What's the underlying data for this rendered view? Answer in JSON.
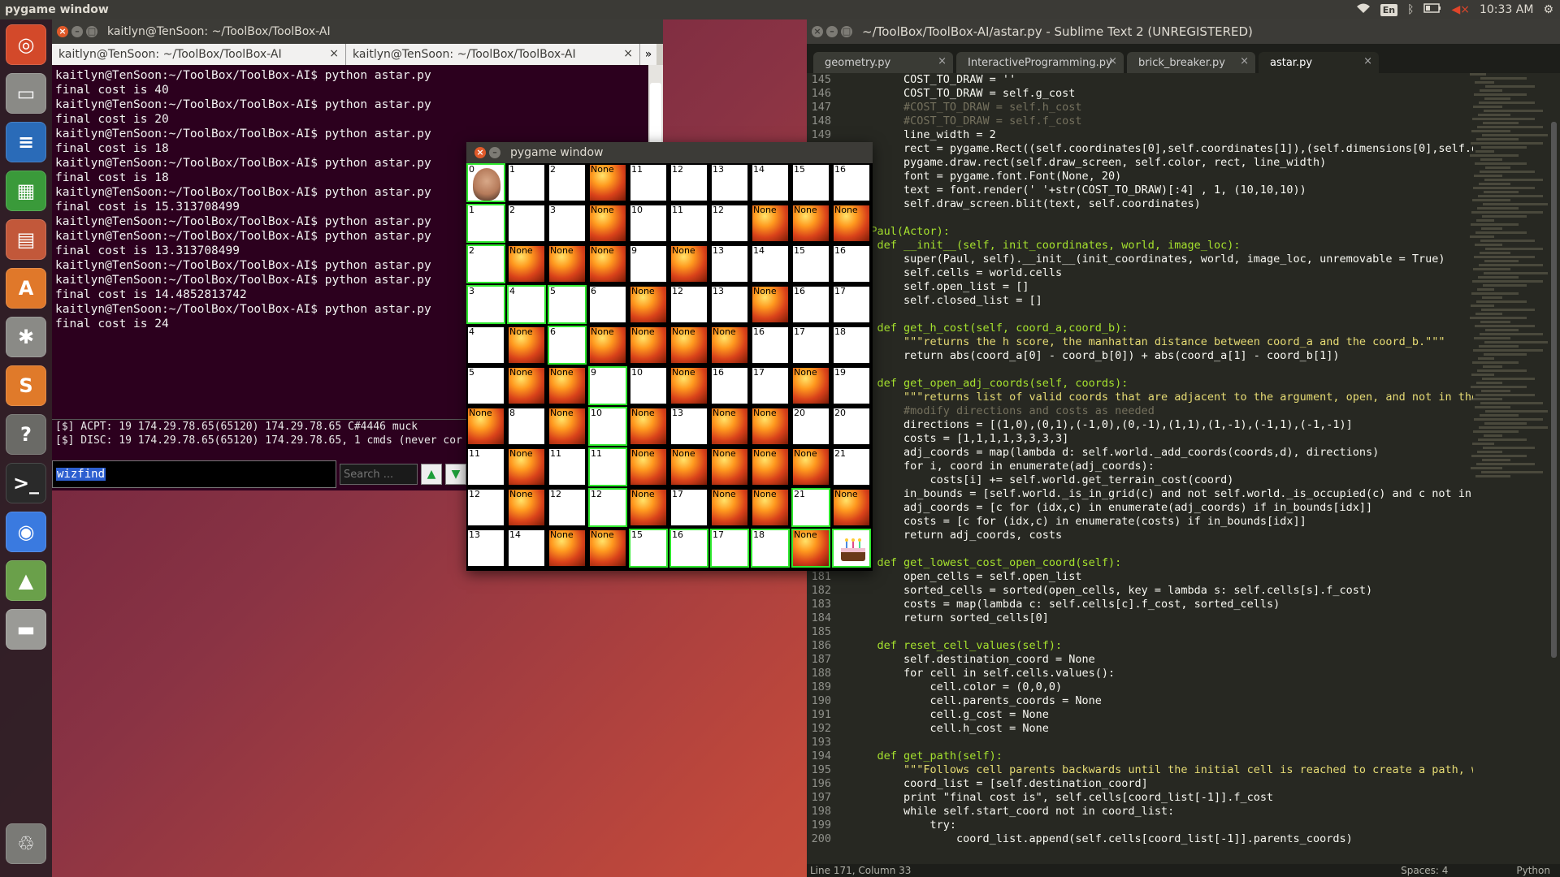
{
  "top_panel": {
    "title": "pygame window",
    "lang": "En",
    "clock": "10:33 AM"
  },
  "launcher": {
    "items": [
      {
        "name": "dash",
        "glyph": "◎",
        "color": "#d3492a"
      },
      {
        "name": "files",
        "glyph": "▭",
        "color": "#8a8a86"
      },
      {
        "name": "writer",
        "glyph": "≡",
        "color": "#2a6bb8"
      },
      {
        "name": "calc",
        "glyph": "▦",
        "color": "#3a9a3a"
      },
      {
        "name": "impress",
        "glyph": "▤",
        "color": "#c2583a"
      },
      {
        "name": "software-center",
        "glyph": "A",
        "color": "#e0782a"
      },
      {
        "name": "settings",
        "glyph": "✱",
        "color": "#8a8a86"
      },
      {
        "name": "sublime",
        "glyph": "S",
        "color": "#e07a2a"
      },
      {
        "name": "help",
        "glyph": "?",
        "color": "#6a6a66"
      },
      {
        "name": "terminal",
        "glyph": ">_",
        "color": "#2a2a2a"
      },
      {
        "name": "chrome",
        "glyph": "◉",
        "color": "#3a7ae0"
      },
      {
        "name": "image-viewer",
        "glyph": "▲",
        "color": "#6aa04a"
      },
      {
        "name": "disk",
        "glyph": "▬",
        "color": "#9a9a96"
      },
      {
        "name": "trash",
        "glyph": "♲",
        "color": "#7a7a76"
      }
    ]
  },
  "terminal": {
    "title": "kaitlyn@TenSoon: ~/ToolBox/ToolBox-AI",
    "tabs": [
      "kaitlyn@TenSoon: ~/ToolBox/ToolBox-AI",
      "kaitlyn@TenSoon: ~/ToolBox/ToolBox-AI"
    ],
    "output": "kaitlyn@TenSoon:~/ToolBox/ToolBox-AI$ python astar.py\nfinal cost is 40\nkaitlyn@TenSoon:~/ToolBox/ToolBox-AI$ python astar.py\nfinal cost is 20\nkaitlyn@TenSoon:~/ToolBox/ToolBox-AI$ python astar.py\nfinal cost is 18\nkaitlyn@TenSoon:~/ToolBox/ToolBox-AI$ python astar.py\nfinal cost is 18\nkaitlyn@TenSoon:~/ToolBox/ToolBox-AI$ python astar.py\nfinal cost is 15.313708499\nkaitlyn@TenSoon:~/ToolBox/ToolBox-AI$ python astar.py\nkaitlyn@TenSoon:~/ToolBox/ToolBox-AI$ python astar.py\nfinal cost is 13.313708499\nkaitlyn@TenSoon:~/ToolBox/ToolBox-AI$ python astar.py\nkaitlyn@TenSoon:~/ToolBox/ToolBox-AI$ python astar.py\nfinal cost is 14.4852813742\nkaitlyn@TenSoon:~/ToolBox/ToolBox-AI$ python astar.py\nfinal cost is 24",
    "irc_log": "[$] ACPT: 19 174.29.78.65(65120) 174.29.78.65 C#4446 muck\n[$] DISC: 19 174.29.78.65(65120) 174.29.78.65, 1 cmds (never cor",
    "input_value": "wizfind",
    "search_placeholder": "Search ...",
    "more_glyph": "»"
  },
  "pygame": {
    "title": "pygame window",
    "none_label": "None",
    "grid": [
      [
        {
          "t": "0",
          "k": "avatar",
          "g": 1
        },
        {
          "t": "1"
        },
        {
          "t": "2"
        },
        {
          "t": "None",
          "k": "fire"
        },
        {
          "t": "11"
        },
        {
          "t": "12"
        },
        {
          "t": "13"
        },
        {
          "t": "14"
        },
        {
          "t": "15"
        },
        {
          "t": "16"
        }
      ],
      [
        {
          "t": "1",
          "g": 1
        },
        {
          "t": "2"
        },
        {
          "t": "3"
        },
        {
          "t": "None",
          "k": "fire"
        },
        {
          "t": "10"
        },
        {
          "t": "11"
        },
        {
          "t": "12"
        },
        {
          "t": "None",
          "k": "fire"
        },
        {
          "t": "None",
          "k": "fire"
        },
        {
          "t": "None",
          "k": "fire"
        }
      ],
      [
        {
          "t": "2",
          "g": 1
        },
        {
          "t": "None",
          "k": "fire"
        },
        {
          "t": "None",
          "k": "fire"
        },
        {
          "t": "None",
          "k": "fire"
        },
        {
          "t": "9"
        },
        {
          "t": "None",
          "k": "fire"
        },
        {
          "t": "13"
        },
        {
          "t": "14"
        },
        {
          "t": "15"
        },
        {
          "t": "16"
        }
      ],
      [
        {
          "t": "3",
          "g": 1
        },
        {
          "t": "4",
          "g": 1
        },
        {
          "t": "5",
          "g": 1
        },
        {
          "t": "6"
        },
        {
          "t": "None",
          "k": "fire"
        },
        {
          "t": "12"
        },
        {
          "t": "13"
        },
        {
          "t": "None",
          "k": "fire"
        },
        {
          "t": "16"
        },
        {
          "t": "17"
        }
      ],
      [
        {
          "t": "4"
        },
        {
          "t": "None",
          "k": "fire"
        },
        {
          "t": "6",
          "g": 1
        },
        {
          "t": "None",
          "k": "fire"
        },
        {
          "t": "None",
          "k": "fire"
        },
        {
          "t": "None",
          "k": "fire"
        },
        {
          "t": "None",
          "k": "fire"
        },
        {
          "t": "16"
        },
        {
          "t": "17"
        },
        {
          "t": "18"
        }
      ],
      [
        {
          "t": "5"
        },
        {
          "t": "None",
          "k": "fire"
        },
        {
          "t": "None",
          "k": "fire"
        },
        {
          "t": "9",
          "g": 1
        },
        {
          "t": "10"
        },
        {
          "t": "None",
          "k": "fire"
        },
        {
          "t": "16"
        },
        {
          "t": "17"
        },
        {
          "t": "None",
          "k": "fire"
        },
        {
          "t": "19"
        }
      ],
      [
        {
          "t": "None",
          "k": "fire"
        },
        {
          "t": "8"
        },
        {
          "t": "None",
          "k": "fire"
        },
        {
          "t": "10",
          "g": 1
        },
        {
          "t": "None",
          "k": "fire"
        },
        {
          "t": "13"
        },
        {
          "t": "None",
          "k": "fire"
        },
        {
          "t": "None",
          "k": "fire"
        },
        {
          "t": "20"
        },
        {
          "t": "20"
        }
      ],
      [
        {
          "t": "11"
        },
        {
          "t": "None",
          "k": "fire"
        },
        {
          "t": "11"
        },
        {
          "t": "11",
          "g": 1
        },
        {
          "t": "None",
          "k": "fire"
        },
        {
          "t": "None",
          "k": "fire"
        },
        {
          "t": "None",
          "k": "fire"
        },
        {
          "t": "None",
          "k": "fire"
        },
        {
          "t": "None",
          "k": "fire"
        },
        {
          "t": "21"
        }
      ],
      [
        {
          "t": "12"
        },
        {
          "t": "None",
          "k": "fire"
        },
        {
          "t": "12"
        },
        {
          "t": "12",
          "g": 1
        },
        {
          "t": "None",
          "k": "fire"
        },
        {
          "t": "17"
        },
        {
          "t": "None",
          "k": "fire"
        },
        {
          "t": "None",
          "k": "fire"
        },
        {
          "t": "21",
          "g": 1
        },
        {
          "t": "None",
          "k": "fire"
        }
      ],
      [
        {
          "t": "13"
        },
        {
          "t": "14"
        },
        {
          "t": "None",
          "k": "fire"
        },
        {
          "t": "None",
          "k": "fire"
        },
        {
          "t": "15",
          "g": 1
        },
        {
          "t": "16",
          "g": 1
        },
        {
          "t": "17",
          "g": 1
        },
        {
          "t": "18",
          "g": 1
        },
        {
          "t": "None",
          "k": "fire",
          "g": 1
        },
        {
          "t": "",
          "k": "cake",
          "g": 1
        }
      ]
    ]
  },
  "sublime": {
    "title": "~/ToolBox/ToolBox-AI/astar.py - Sublime Text 2 (UNREGISTERED)",
    "tabs": [
      {
        "label": "geometry.py",
        "active": false
      },
      {
        "label": "InteractiveProgramming.py",
        "active": false
      },
      {
        "label": "brick_breaker.py",
        "active": false
      },
      {
        "label": "astar.py",
        "active": true
      }
    ],
    "code_lines": [
      [
        "145",
        "        COST_TO_DRAW = ''"
      ],
      [
        "146",
        "        COST_TO_DRAW = self.g_cost"
      ],
      [
        "147",
        "        #COST_TO_DRAW = self.h_cost"
      ],
      [
        "148",
        "        #COST_TO_DRAW = self.f_cost"
      ],
      [
        "149",
        "        line_width = 2"
      ],
      [
        "",
        "        rect = pygame.Rect((self.coordinates[0],self.coordinates[1]),(self.dimensions[0],self.d"
      ],
      [
        "",
        "        pygame.draw.rect(self.draw_screen, self.color, rect, line_width)"
      ],
      [
        "",
        "        font = pygame.font.Font(None, 20)"
      ],
      [
        "",
        "        text = font.render(' '+str(COST_TO_DRAW)[:4] , 1, (10,10,10))"
      ],
      [
        "",
        "        self.draw_screen.blit(text, self.coordinates)"
      ],
      [
        "",
        ""
      ],
      [
        "",
        "ss Paul(Actor):"
      ],
      [
        "",
        "    def __init__(self, init_coordinates, world, image_loc):"
      ],
      [
        "",
        "        super(Paul, self).__init__(init_coordinates, world, image_loc, unremovable = True)"
      ],
      [
        "",
        "        self.cells = world.cells"
      ],
      [
        "",
        "        self.open_list = []"
      ],
      [
        "",
        "        self.closed_list = []"
      ],
      [
        "",
        ""
      ],
      [
        "",
        "    def get_h_cost(self, coord_a,coord_b):"
      ],
      [
        "",
        "        \"\"\"returns the h score, the manhattan distance between coord_a and the coord_b.\"\"\""
      ],
      [
        "",
        "        return abs(coord_a[0] - coord_b[0]) + abs(coord_a[1] - coord_b[1])"
      ],
      [
        "",
        ""
      ],
      [
        "",
        "    def get_open_adj_coords(self, coords):"
      ],
      [
        "",
        "        \"\"\"returns list of valid coords that are adjacent to the argument, open, and not in the"
      ],
      [
        "",
        "        #modify directions and costs as needed"
      ],
      [
        "",
        "        directions = [(1,0),(0,1),(-1,0),(0,-1),(1,1),(1,-1),(-1,1),(-1,-1)]"
      ],
      [
        "",
        "        costs = [1,1,1,1,3,3,3,3]"
      ],
      [
        "",
        "        adj_coords = map(lambda d: self.world._add_coords(coords,d), directions)"
      ],
      [
        "",
        "        for i, coord in enumerate(adj_coords):"
      ],
      [
        "",
        "            costs[i] += self.world.get_terrain_cost(coord)"
      ],
      [
        "",
        "        in_bounds = [self.world._is_in_grid(c) and not self.world._is_occupied(c) and c not in"
      ],
      [
        "",
        "        adj_coords = [c for (idx,c) in enumerate(adj_coords) if in_bounds[idx]]"
      ],
      [
        "",
        "        costs = [c for (idx,c) in enumerate(costs) if in_bounds[idx]]"
      ],
      [
        "",
        "        return adj_coords, costs"
      ],
      [
        "",
        ""
      ],
      [
        "",
        "    def get_lowest_cost_open_coord(self):"
      ],
      [
        "181",
        "        open_cells = self.open_list"
      ],
      [
        "182",
        "        sorted_cells = sorted(open_cells, key = lambda s: self.cells[s].f_cost)"
      ],
      [
        "183",
        "        costs = map(lambda c: self.cells[c].f_cost, sorted_cells)"
      ],
      [
        "184",
        "        return sorted_cells[0]"
      ],
      [
        "185",
        ""
      ],
      [
        "186",
        "    def reset_cell_values(self):"
      ],
      [
        "187",
        "        self.destination_coord = None"
      ],
      [
        "188",
        "        for cell in self.cells.values():"
      ],
      [
        "189",
        "            cell.color = (0,0,0)"
      ],
      [
        "190",
        "            cell.parents_coords = None"
      ],
      [
        "191",
        "            cell.g_cost = None"
      ],
      [
        "192",
        "            cell.h_cost = None"
      ],
      [
        "193",
        ""
      ],
      [
        "194",
        "    def get_path(self):"
      ],
      [
        "195",
        "        \"\"\"Follows cell parents backwards until the initial cell is reached to create a path, w"
      ],
      [
        "196",
        "        coord_list = [self.destination_coord]"
      ],
      [
        "197",
        "        print \"final cost is\", self.cells[coord_list[-1]].f_cost"
      ],
      [
        "198",
        "        while self.start_coord not in coord_list:"
      ],
      [
        "199",
        "            try:"
      ],
      [
        "200",
        "                coord_list.append(self.cells[coord_list[-1]].parents_coords)"
      ]
    ],
    "status_left": "Line 171, Column 33",
    "status_spaces": "Spaces: 4",
    "status_syntax": "Python"
  }
}
